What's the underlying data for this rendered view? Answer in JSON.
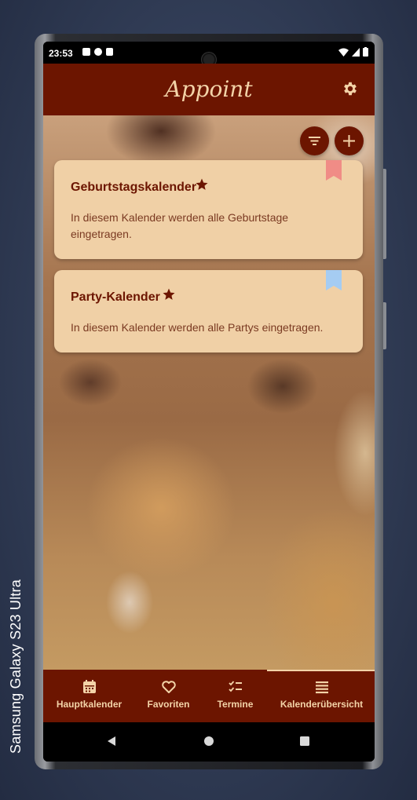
{
  "device": {
    "label": "Samsung Galaxy  S23 Ultra"
  },
  "status_bar": {
    "time": "23:53",
    "left_icons": [
      "photo-icon",
      "face-icon",
      "sd-card-icon"
    ],
    "right_icons": [
      "wifi-icon",
      "signal-icon",
      "battery-icon"
    ]
  },
  "app_bar": {
    "title": "Appoint",
    "settings_icon": "gear-icon"
  },
  "actions": {
    "filter_icon": "filter-icon",
    "add_icon": "plus-icon"
  },
  "calendars": [
    {
      "title": "Geburtstagskalender",
      "favorite": true,
      "description": "In diesem Kalender werden alle Geburtstage eingetragen.",
      "bookmark_color": "#f08c86"
    },
    {
      "title": "Party-Kalender",
      "favorite": true,
      "description": "In diesem Kalender werden alle Partys eingetragen.",
      "bookmark_color": "#a5ccf2"
    }
  ],
  "bottom_nav": {
    "items": [
      {
        "label": "Hauptkalender",
        "icon": "calendar-icon",
        "active": false
      },
      {
        "label": "Favoriten",
        "icon": "heart-icon",
        "active": false
      },
      {
        "label": "Termine",
        "icon": "checklist-icon",
        "active": false
      },
      {
        "label": "Kalenderübersicht",
        "icon": "list-icon",
        "active": true
      }
    ]
  },
  "system_nav": [
    "back-icon",
    "home-icon",
    "recents-icon"
  ],
  "colors": {
    "primary": "#6c1500",
    "accent": "#f3d3a8",
    "card": "#f0d0a6"
  }
}
